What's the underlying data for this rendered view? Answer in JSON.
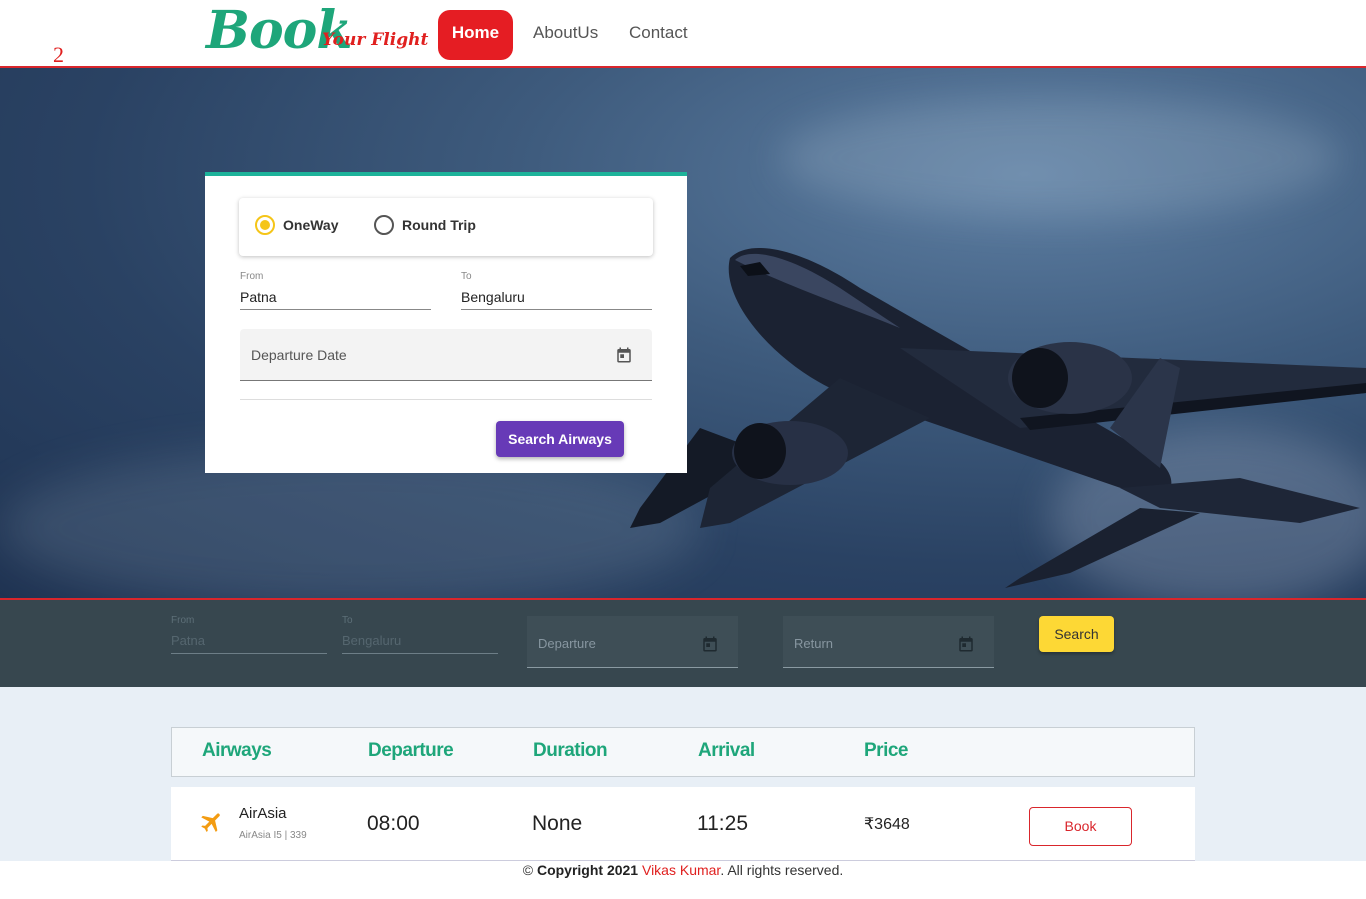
{
  "page_marker": "2",
  "brand": {
    "title": "Book",
    "subtitle": "Your Flight"
  },
  "nav": {
    "home": "Home",
    "about": "AboutUs",
    "contact": "Contact"
  },
  "booking_card": {
    "trip_types": {
      "oneway": "OneWay",
      "roundtrip": "Round Trip",
      "selected": "oneway"
    },
    "from": {
      "label": "From",
      "value": "Patna"
    },
    "to": {
      "label": "To",
      "value": "Bengaluru"
    },
    "departure_placeholder": "Departure Date",
    "search_button": "Search Airways"
  },
  "search_bar": {
    "from": {
      "label": "From",
      "value": "Patna"
    },
    "to": {
      "label": "To",
      "value": "Bengaluru"
    },
    "departure_placeholder": "Departure",
    "return_placeholder": "Return",
    "search_button": "Search"
  },
  "results": {
    "columns": [
      "Airways",
      "Departure",
      "Duration",
      "Arrival",
      "Price"
    ],
    "rows": [
      {
        "airline": "AirAsia",
        "code": "AirAsia I5 | 339",
        "departure": "08:00",
        "duration": "None",
        "arrival": "11:25",
        "price": "₹3648",
        "action": "Book",
        "icon": "airplane-icon"
      }
    ]
  },
  "footer": {
    "copyright_symbol": "©",
    "copyright_text": "Copyright 2021",
    "author": "Vikas Kumar",
    "rights": ". All rights reserved."
  },
  "colors": {
    "brand_green": "#1ea67a",
    "brand_red": "#e0201f",
    "accent_purple": "#673ab7",
    "accent_yellow": "#fdd835",
    "airplane_orange": "#f39c12"
  }
}
